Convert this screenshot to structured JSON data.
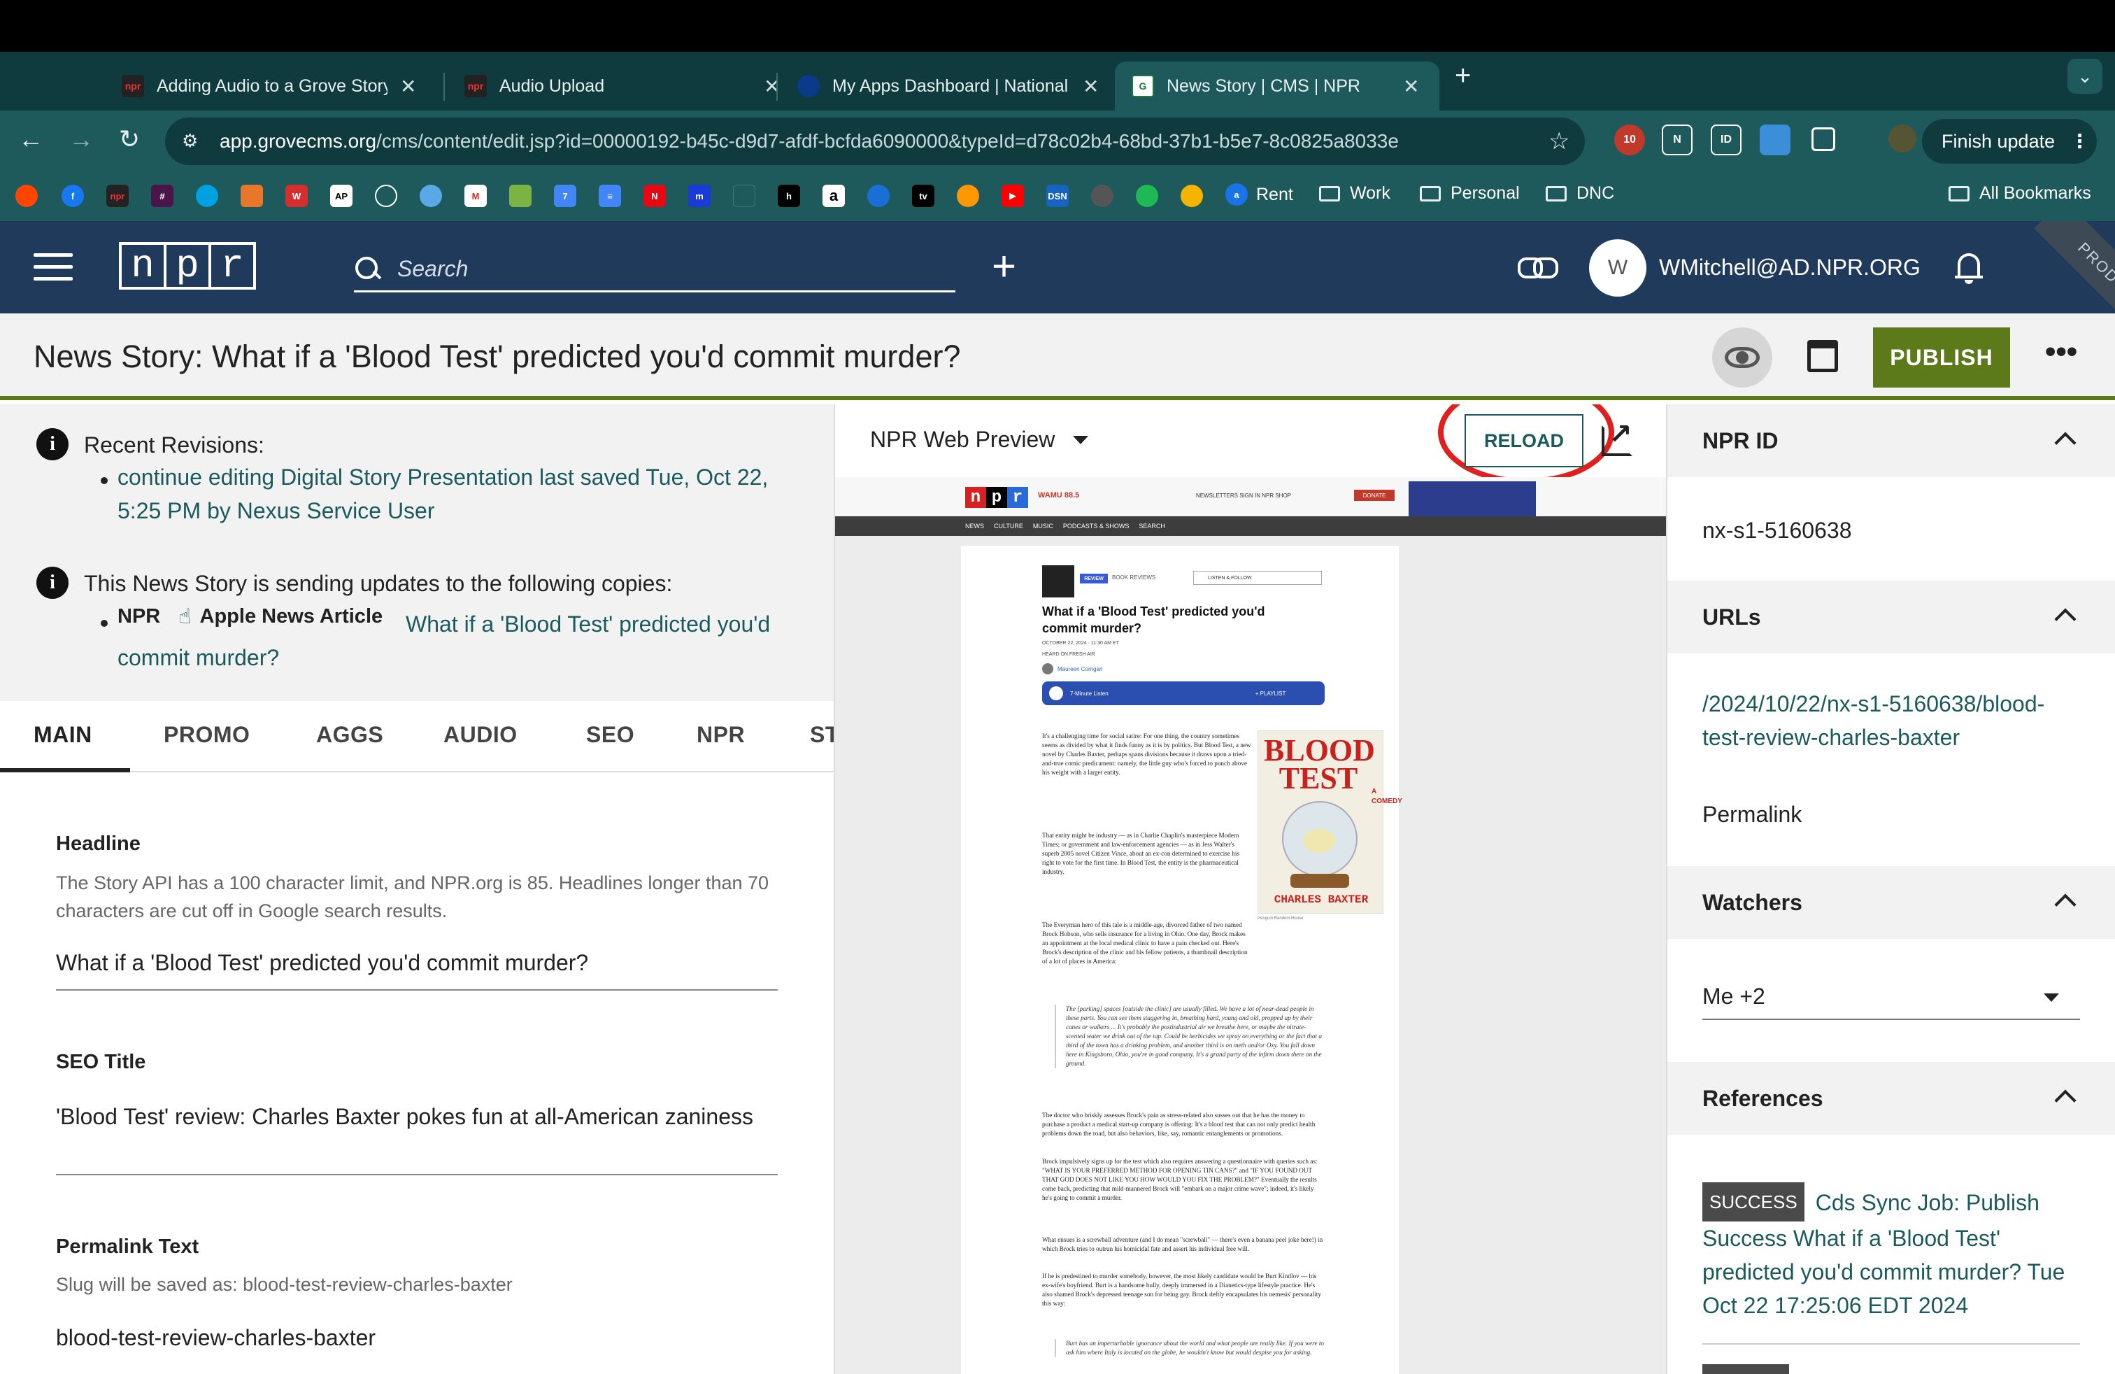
{
  "browser": {
    "tabs": [
      {
        "title": "Adding Audio to a Grove Story",
        "favicon": "npr",
        "active": false
      },
      {
        "title": "Audio Upload",
        "favicon": "npr",
        "active": false
      },
      {
        "title": "My Apps Dashboard | National Public Radio",
        "favicon": "okta",
        "active": false
      },
      {
        "title": "News Story | CMS | NPR",
        "favicon": "grove",
        "active": true
      }
    ],
    "url_host": "app.grovecms.org",
    "url_path": "/cms/content/edit.jsp?id=00000192-b45c-d9d7-afdf-bcfda6090000&typeId=d78c02b4-68bd-37b1-b5e7-8c0825a8033e",
    "finish_update_label": "Finish update",
    "extension_badge": "10",
    "bookmarks": [
      {
        "label": "Rent",
        "type": "link"
      },
      {
        "label": "Work",
        "type": "folder"
      },
      {
        "label": "Personal",
        "type": "folder"
      },
      {
        "label": "DNC",
        "type": "folder"
      },
      {
        "label": "All Bookmarks",
        "type": "folder"
      }
    ]
  },
  "header": {
    "logo_letters": [
      "n",
      "p",
      "r"
    ],
    "search_placeholder": "Search",
    "user_initial": "W",
    "user_email": "WMitchell@AD.NPR.ORG",
    "env_badge": "PROD"
  },
  "titlebar": {
    "title": "News Story: What if a 'Blood Test' predicted you'd commit murder?",
    "publish_label": "PUBLISH"
  },
  "notices": {
    "revisions_heading": "Recent Revisions:",
    "revision_link": "continue editing Digital Story Presentation last saved Tue, Oct 22, 5:25 PM by Nexus Service User",
    "copies_heading": "This News Story is sending updates to the following copies:",
    "copy_source": "NPR",
    "copy_type": "Apple News Article",
    "copy_link": "What if a 'Blood Test' predicted you'd commit murder?"
  },
  "edit_tabs": [
    "MAIN",
    "PROMO",
    "AGGS",
    "AUDIO",
    "SEO",
    "NPR",
    "ST"
  ],
  "fields": {
    "headline_label": "Headline",
    "headline_help": "The Story API has a 100 character limit, and NPR.org is 85. Headlines longer than 70 characters are cut off in Google search results.",
    "headline_value": "What if a 'Blood Test' predicted you'd commit murder?",
    "seo_title_label": "SEO Title",
    "seo_title_value": "'Blood Test' review: Charles Baxter pokes fun at all-American zaniness",
    "permalink_label": "Permalink Text",
    "permalink_help": "Slug will be saved as: blood-test-review-charles-baxter",
    "permalink_value": "blood-test-review-charles-baxter"
  },
  "preview": {
    "selector_label": "NPR Web Preview",
    "reload_label": "RELOAD",
    "site": {
      "station": "WAMU 88.5",
      "top_links": "NEWSLETTERS   SIGN IN   NPR SHOP",
      "donate": "DONATE",
      "nav": [
        "NEWS",
        "CULTURE",
        "MUSIC",
        "PODCASTS & SHOWS",
        "SEARCH"
      ],
      "review_tag": "REVIEW",
      "section": "BOOK REVIEWS",
      "listen_follow": "LISTEN & FOLLOW",
      "article_title": "What if a 'Blood Test' predicted you'd commit murder?",
      "date": "OCTOBER 22, 2024 · 11:30 AM ET",
      "heard_on": "HEARD ON FRESH AIR",
      "author": "Maureen Corrigan",
      "audio_label": "7-Minute Listen",
      "audio_playlist": "+ PLAYLIST",
      "cover_title": "BLOOD TEST",
      "cover_subtitle": "A COMEDY",
      "cover_author": "CHARLES BAXTER",
      "cover_caption": "Penguin Random House",
      "para1": "It's a challenging time for social satire: For one thing, the country sometimes seems as divided by what it finds funny as it is by politics. But Blood Test, a new novel by Charles Baxter, perhaps spans divisions because it draws upon a tried-and-true comic predicament: namely, the little guy who's forced to punch above his weight with a larger entity.",
      "para2": "That entity might be industry — as in Charlie Chaplin's masterpiece Modern Times; or government and law-enforcement agencies — as in Jess Walter's superb 2005 novel Citizen Vince, about an ex-con determined to exercise his right to vote for the first time. In Blood Test, the entity is the pharmaceutical industry.",
      "para3": "The Everyman hero of this tale is a middle-age, divorced father of two named Brock Hobson, who sells insurance for a living in Ohio. One day, Brock makes an appointment at the local medical clinic to have a pain checked out. Here's Brock's description of the clinic and his fellow patients, a thumbnail description of a lot of places in America:",
      "quote1": "The [parking] spaces [outside the clinic] are usually filled. We have a lot of near-dead people in these parts. You can see them staggering in, breathing hard, young and old, propped up by their canes or walkers ... It's probably the postindustrial air we breathe here, or maybe the nitrate-scented water we drink out of the tap. Could be herbicides we spray on everything or the fact that a third of the town has a drinking problem, and another third is on meth and/or Oxy. You fall down here in Kingsboro, Ohio, you're in good company. It's a grand party of the infirm down there on the ground.",
      "para4": "The doctor who briskly assesses Brock's pain as stress-related also susses out that he has the money to purchase a product a medical start-up company is offering: It's a blood test that can not only predict health problems down the road, but also behaviors, like, say, romantic entanglements or promotions.",
      "para5": "Brock impulsively signs up for the test which also requires answering a questionnaire with queries such as: \"WHAT IS YOUR PREFERRED METHOD FOR OPENING TIN CANS?\" and \"IF YOU FOUND OUT THAT GOD DOES NOT LIKE YOU HOW WOULD YOU FIX THE PROBLEM?\" Eventually the results come back, predicting that mild-mannered Brock will \"embark on a major crime wave\"; indeed, it's likely he's going to commit a murder.",
      "para6": "What ensues is a screwball adventure (and I do mean \"screwball\" — there's even a banana peel joke here!) in which Brock tries to outrun his homicidal fate and assert his individual free will.",
      "para7": "If he is predestined to murder somebody, however, the most likely candidate would be Burt Kindlov — his ex-wife's boyfriend. Burt is a handsome bully, deeply immersed in a Dianetics-type lifestyle practice. He's also shamed Brock's depressed teenage son for being gay. Brock deftly encapsulates his nemesis' personality this way:",
      "quote2": "Burt has an imperturbable ignorance about the world and what people are really like. If you were to ask him where Italy is located on the globe, he wouldn't know but would despise you for asking."
    }
  },
  "sidebar": {
    "npr_id_title": "NPR ID",
    "npr_id_value": "nx-s1-5160638",
    "urls_title": "URLs",
    "url_link": "/2024/10/22/nx-s1-5160638/blood-test-review-charles-baxter",
    "url_kind": "Permalink",
    "watchers_title": "Watchers",
    "watchers_value": "Me +2",
    "references_title": "References",
    "ref_badge": "SUCCESS",
    "ref_text": "Cds Sync Job: Publish Success What if a 'Blood Test' predicted you'd commit murder? Tue Oct 22 17:25:06 EDT 2024"
  },
  "colors": {
    "browser_dark": "#0f3b3f",
    "browser_mid": "#1e5a5c",
    "npr_header": "#1f3a5a",
    "publish_green": "#5c7a1a",
    "link_teal": "#1b5a5c",
    "annotation_red": "#e0201f"
  }
}
